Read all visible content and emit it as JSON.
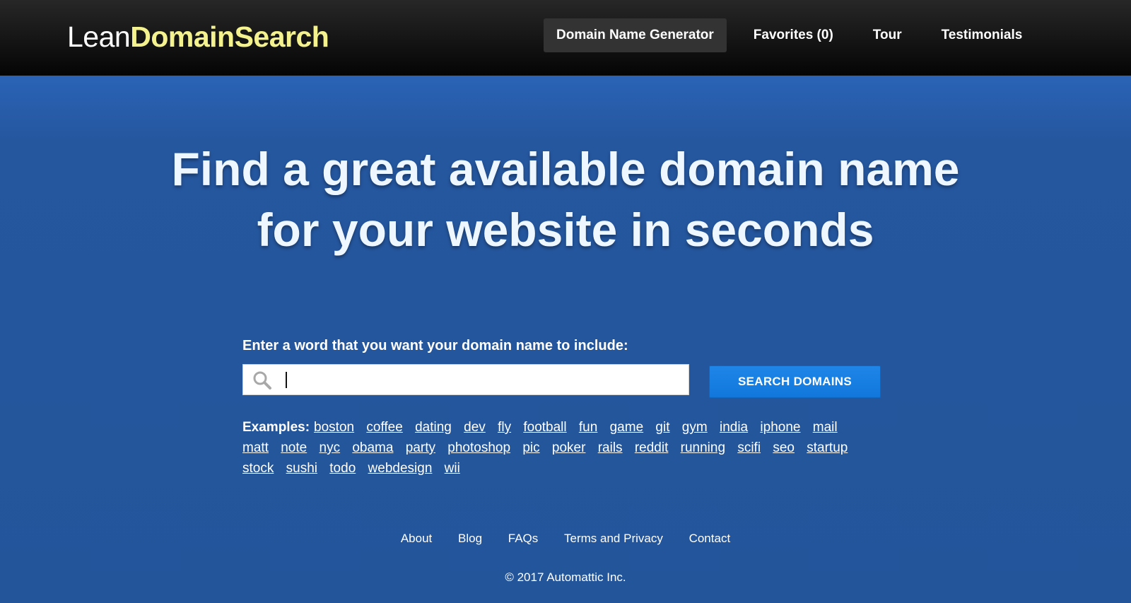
{
  "logo": {
    "part1": "Lean",
    "part2": "DomainSearch"
  },
  "nav": {
    "items": [
      {
        "label": "Domain Name Generator",
        "active": true
      },
      {
        "label": "Favorites (0)"
      },
      {
        "label": "Tour"
      },
      {
        "label": "Testimonials"
      }
    ]
  },
  "hero": {
    "line1": "Find a great available domain name",
    "line2": "for your website in seconds"
  },
  "search": {
    "label": "Enter a word that you want your domain name to include:",
    "value": "",
    "button_label": "SEARCH DOMAINS"
  },
  "examples": {
    "label": "Examples:",
    "words": [
      "boston",
      "coffee",
      "dating",
      "dev",
      "fly",
      "football",
      "fun",
      "game",
      "git",
      "gym",
      "india",
      "iphone",
      "mail",
      "matt",
      "note",
      "nyc",
      "obama",
      "party",
      "photoshop",
      "pic",
      "poker",
      "rails",
      "reddit",
      "running",
      "scifi",
      "seo",
      "startup",
      "stock",
      "sushi",
      "todo",
      "webdesign",
      "wii"
    ]
  },
  "footer": {
    "links": [
      "About",
      "Blog",
      "FAQs",
      "Terms and Privacy",
      "Contact"
    ],
    "copyright": "© 2017 Automattic Inc."
  },
  "colors": {
    "header_bg": "#111111",
    "hero_bg": "#23559b",
    "logo_accent": "#f4f28e",
    "button_bg": "#1a80e4"
  },
  "icons": {
    "search": "magnifier-icon"
  }
}
